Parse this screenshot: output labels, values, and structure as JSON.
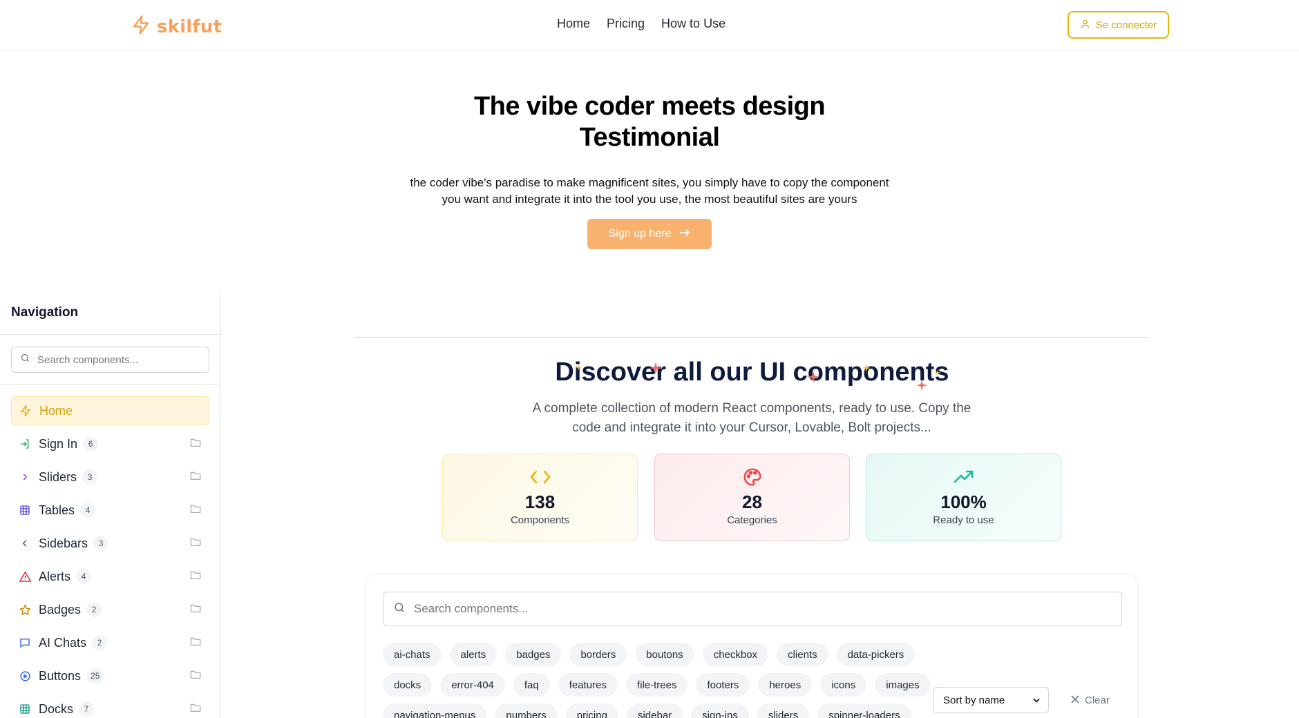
{
  "brand": {
    "name": "skilfut",
    "accent": "#f5a25d"
  },
  "nav": [
    "Home",
    "Pricing",
    "How to Use"
  ],
  "login_label": "Se connecter",
  "hero": {
    "title": "The vibe coder meets design",
    "title_bold": "Testimonial",
    "subtitle": "the coder vibe's paradise to make magnificent sites, you simply have to copy the component you want and integrate it into the tool you use, the most beautiful sites are yours",
    "cta": "Sign up here"
  },
  "sidebar": {
    "title": "Navigation",
    "search_placeholder": "Search components...",
    "items": [
      {
        "label": "Home",
        "count": null,
        "icon": "bolt-icon",
        "color": "#eab308"
      },
      {
        "label": "Sign In",
        "count": "6",
        "icon": "sign-in-icon",
        "color": "#16a34a"
      },
      {
        "label": "Sliders",
        "count": "3",
        "icon": "chevron-right-icon",
        "color": "#9333ea"
      },
      {
        "label": "Tables",
        "count": "4",
        "icon": "table-icon",
        "color": "#4f46e5"
      },
      {
        "label": "Sidebars",
        "count": "3",
        "icon": "chevron-left-icon",
        "color": "#4b5563"
      },
      {
        "label": "Alerts",
        "count": "4",
        "icon": "alert-triangle-icon",
        "color": "#dc2626"
      },
      {
        "label": "Badges",
        "count": "2",
        "icon": "star-icon",
        "color": "#ca8a04"
      },
      {
        "label": "AI Chats",
        "count": "2",
        "icon": "chat-icon",
        "color": "#2563eb"
      },
      {
        "label": "Buttons",
        "count": "25",
        "icon": "button-icon",
        "color": "#2563eb"
      },
      {
        "label": "Docks",
        "count": "7",
        "icon": "grid-icon",
        "color": "#0d9488"
      }
    ]
  },
  "discover": {
    "title": "Discover all our UI components",
    "subtitle": "A complete collection of modern React components, ready to use. Copy the code and integrate it into your Cursor, Lovable, Bolt projects..."
  },
  "stats": [
    {
      "value": "138",
      "label": "Components",
      "icon": "code-icon",
      "color": "#eab308"
    },
    {
      "value": "28",
      "label": "Categories",
      "icon": "palette-icon",
      "color": "#ef4444"
    },
    {
      "value": "100%",
      "label": "Ready to use",
      "icon": "trending-up-icon",
      "color": "#14b8a6"
    }
  ],
  "library": {
    "search_placeholder": "Search components...",
    "tags_row1": [
      "ai-chats",
      "alerts",
      "badges",
      "borders",
      "boutons",
      "checkbox",
      "clients",
      "data-pickers"
    ],
    "tags_row2": [
      "docks",
      "error-404",
      "faq",
      "features",
      "file-trees",
      "footers",
      "heroes",
      "icons",
      "images"
    ],
    "tags_row3": [
      "navigation-menus",
      "numbers",
      "pricing",
      "sidebar",
      "sign-ins",
      "sliders",
      "spinner-loaders"
    ],
    "sort_selected": "Sort by name",
    "clear_label": "Clear"
  }
}
